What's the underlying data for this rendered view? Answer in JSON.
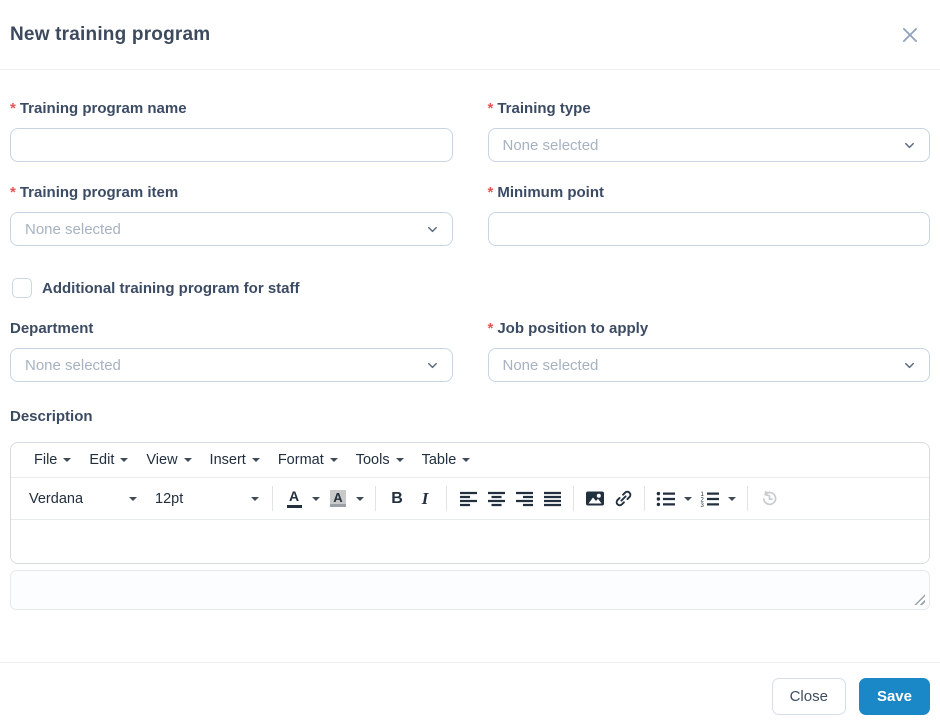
{
  "modal": {
    "title": "New training program"
  },
  "form": {
    "name": {
      "label": "Training program name",
      "required": "*",
      "value": ""
    },
    "type": {
      "label": "Training type",
      "required": "*",
      "placeholder": "None selected"
    },
    "item": {
      "label": "Training program item",
      "required": "*",
      "placeholder": "None selected"
    },
    "min_point": {
      "label": "Minimum point",
      "required": "*",
      "value": ""
    },
    "additional_staff": {
      "label": "Additional training program for staff",
      "checked": false
    },
    "department": {
      "label": "Department",
      "placeholder": "None selected"
    },
    "job_position": {
      "label": "Job position to apply",
      "required": "*",
      "placeholder": "None selected"
    },
    "description": {
      "label": "Description"
    }
  },
  "editor": {
    "menus": [
      "File",
      "Edit",
      "View",
      "Insert",
      "Format",
      "Tools",
      "Table"
    ],
    "toolbar": {
      "font_family": "Verdana",
      "font_size": "12pt",
      "icons": [
        "text-color",
        "background-color",
        "bold",
        "italic",
        "align-left",
        "align-center",
        "align-right",
        "align-justify",
        "insert-image",
        "insert-link",
        "bullet-list",
        "numbered-list",
        "restore-draft"
      ]
    },
    "content": ""
  },
  "footer": {
    "close": "Close",
    "save": "Save"
  },
  "colors": {
    "primary_blue": "#1a87c7",
    "required_red": "#e55353",
    "label_text": "#3c4b64",
    "placeholder_text": "#a6b2c2",
    "input_border": "#c9d4e3",
    "close_icon": "#94a3bd"
  }
}
